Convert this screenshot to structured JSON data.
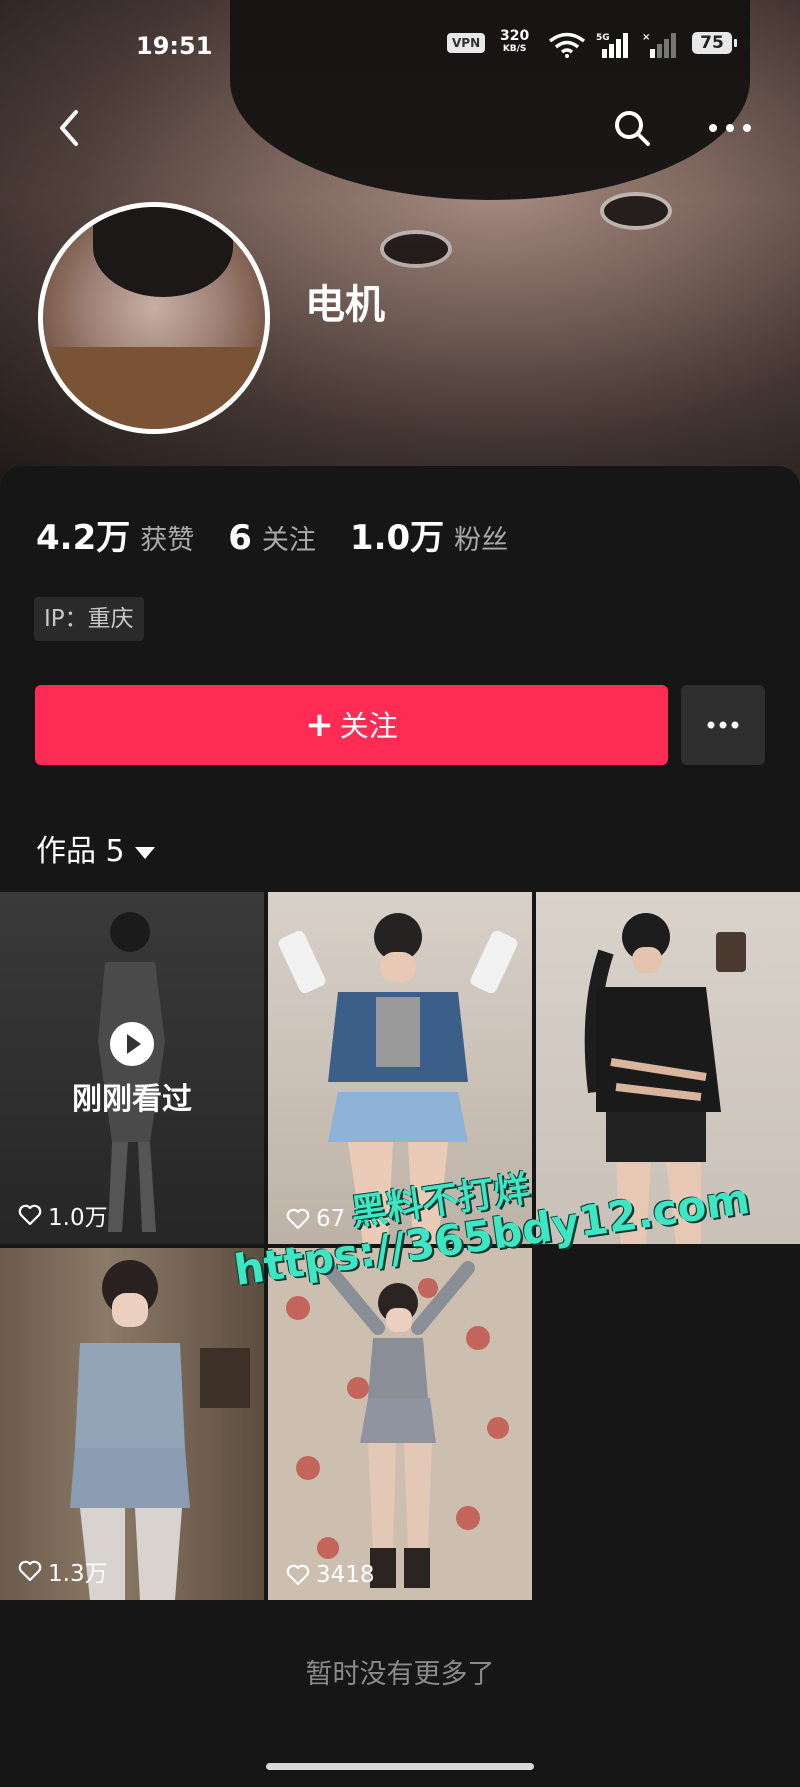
{
  "status_bar": {
    "time": "19:51",
    "vpn": "VPN",
    "net_speed": "320",
    "net_unit": "KB/S",
    "battery": "75"
  },
  "profile": {
    "nickname": "电机",
    "ip_label": "IP：重庆"
  },
  "stats": [
    {
      "num": "4.2万",
      "label": "获赞"
    },
    {
      "num": "6",
      "label": "关注"
    },
    {
      "num": "1.0万",
      "label": "粉丝"
    }
  ],
  "actions": {
    "follow_label": "关注"
  },
  "works": {
    "label": "作品 5"
  },
  "grid": [
    {
      "overlay": "刚刚看过",
      "likes": "1.0万"
    },
    {
      "likes": "67"
    },
    {
      "likes": ""
    },
    {
      "likes": "1.3万"
    },
    {
      "likes": "3418"
    }
  ],
  "watermark": {
    "line1": "黑料不打烊",
    "line2": "https://365bdy12.com"
  },
  "footer": {
    "no_more": "暂时没有更多了"
  },
  "colors": {
    "accent": "#fe2c55",
    "background": "#161616",
    "watermark": "#3fe6c4"
  }
}
